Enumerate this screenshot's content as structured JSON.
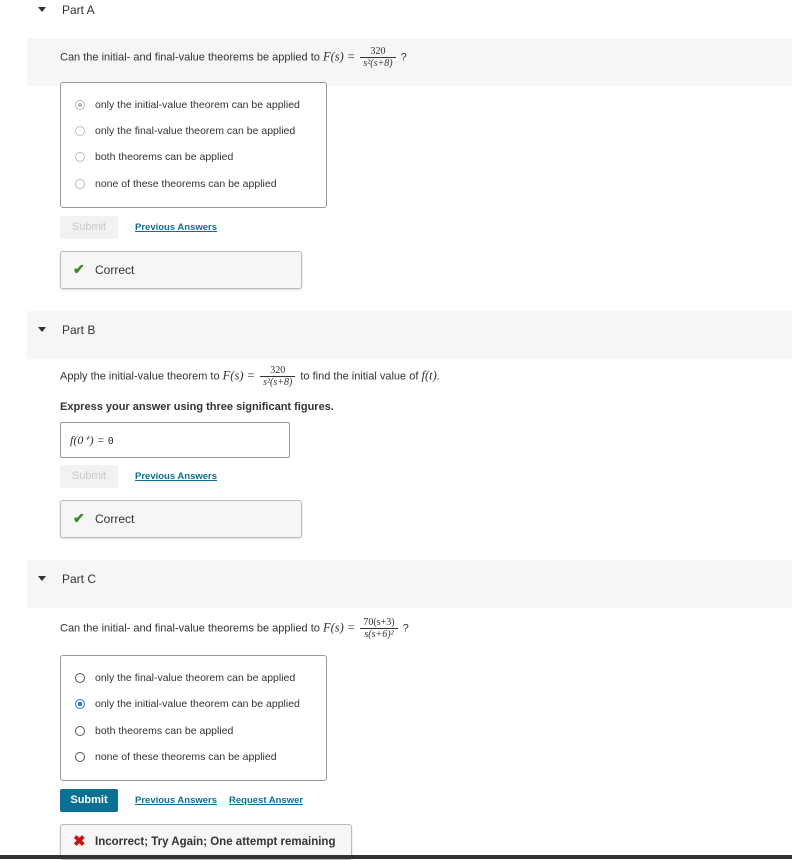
{
  "partA": {
    "title": "Part A",
    "question_prefix": "Can the initial- and final-value theorems be applied to",
    "fn": "F(s) =",
    "frac_num": "320",
    "frac_den": "s²(s+8)",
    "question_suffix": "?",
    "options": [
      "only the initial-value theorem can be applied",
      "only the final-value theorem can be applied",
      "both theorems can be applied",
      "none of these theorems can be applied"
    ],
    "selected_index": 0,
    "submit_label": "Submit",
    "prev_answers_label": "Previous Answers",
    "feedback": "Correct"
  },
  "partB": {
    "title": "Part B",
    "question_prefix": "Apply the initial-value theorem to",
    "fn": "F(s) =",
    "frac_num": "320",
    "frac_den": "s²(s+8)",
    "question_middle": "to find the initial value of",
    "target": "f(t)",
    "question_suffix": ".",
    "instruction": "Express your answer using three significant figures.",
    "answer_label": "f(0⁺) =",
    "answer_value": "0",
    "submit_label": "Submit",
    "prev_answers_label": "Previous Answers",
    "feedback": "Correct"
  },
  "partC": {
    "title": "Part C",
    "question_prefix": "Can the initial- and final-value theorems be applied to",
    "fn": "F(s) =",
    "frac_num": "70(s+3)",
    "frac_den": "s(s+6)²",
    "question_suffix": "?",
    "options": [
      "only the final-value theorem can be applied",
      "only the initial-value theorem can be applied",
      "both theorems can be applied",
      "none of these theorems can be applied"
    ],
    "selected_index": 1,
    "submit_label": "Submit",
    "prev_answers_label": "Previous Answers",
    "request_answer_label": "Request Answer",
    "feedback": "Incorrect; Try Again; One attempt remaining"
  },
  "colors": {
    "accent": "#0d6f91",
    "correct": "#3a8a1e",
    "incorrect": "#cc1111",
    "radio_selected": "#1a73e8"
  }
}
